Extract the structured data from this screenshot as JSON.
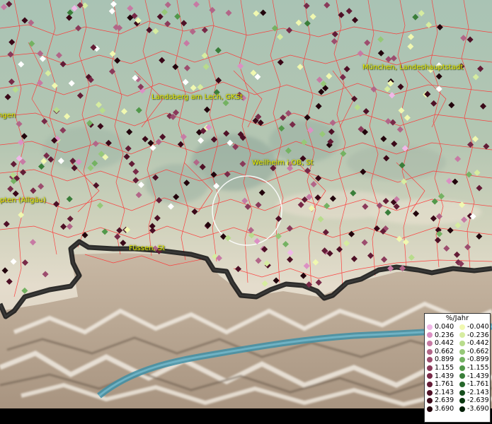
{
  "places": [
    {
      "label": "München, Landeshauptstadt"
    },
    {
      "label": "Landsberg am Lech, GKSt"
    },
    {
      "label": "Weilheim i.OB, St"
    },
    {
      "label": "Kempten (Allgäu)"
    },
    {
      "label": "Füssen, St"
    },
    {
      "label": "Memmingen"
    }
  ],
  "legend": {
    "title": "%/Jahr",
    "positive": [
      {
        "value": "0.040",
        "color": "#f0b8e8"
      },
      {
        "value": "0.236",
        "color": "#dc90c4"
      },
      {
        "value": "0.442",
        "color": "#c77aa4"
      },
      {
        "value": "0.662",
        "color": "#b26688"
      },
      {
        "value": "0.899",
        "color": "#9c4d6e"
      },
      {
        "value": "1.155",
        "color": "#8a3a5a"
      },
      {
        "value": "1.439",
        "color": "#782a48"
      },
      {
        "value": "1.761",
        "color": "#631c36"
      },
      {
        "value": "2.143",
        "color": "#4e1026"
      },
      {
        "value": "2.639",
        "color": "#3a0818"
      },
      {
        "value": "3.690",
        "color": "#22040c"
      }
    ],
    "negative": [
      {
        "value": "-0.040",
        "color": "#f0f8b0"
      },
      {
        "value": "-0.236",
        "color": "#d6eca0"
      },
      {
        "value": "-0.442",
        "color": "#b8dc8c"
      },
      {
        "value": "-0.662",
        "color": "#96c878"
      },
      {
        "value": "-0.899",
        "color": "#74b262"
      },
      {
        "value": "-1.155",
        "color": "#52984a"
      },
      {
        "value": "-1.439",
        "color": "#3a7e3a"
      },
      {
        "value": "-1.761",
        "color": "#26662a"
      },
      {
        "value": "-2.143",
        "color": "#164e1c"
      },
      {
        "value": "-2.639",
        "color": "#0a3810"
      },
      {
        "value": "-3.690",
        "color": "#042008"
      }
    ]
  }
}
